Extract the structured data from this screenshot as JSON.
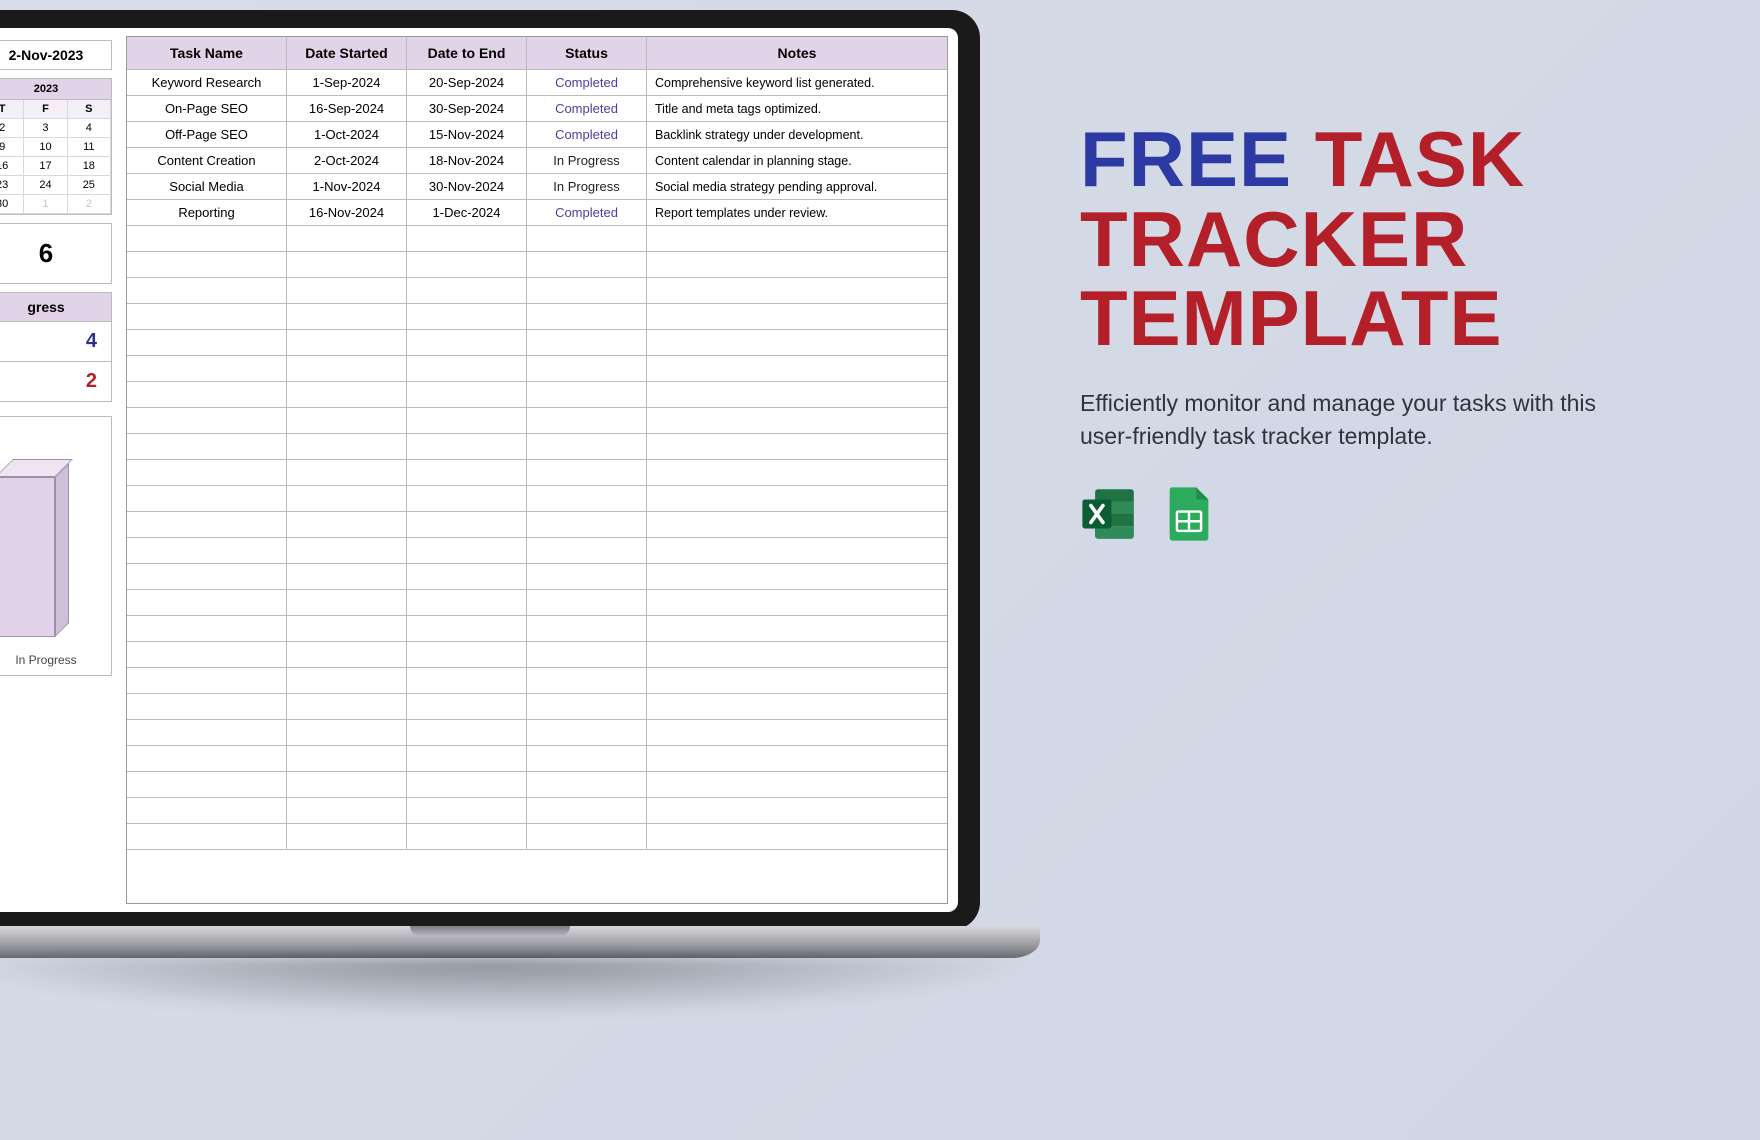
{
  "left": {
    "date_label": "2-Nov-2023",
    "calendar": {
      "year": "2023",
      "day_headers": [
        "T",
        "F",
        "S"
      ],
      "rows": [
        [
          "2",
          "3",
          "4"
        ],
        [
          "9",
          "10",
          "11"
        ],
        [
          "16",
          "17",
          "18"
        ],
        [
          "23",
          "24",
          "25"
        ],
        [
          "30",
          "1",
          "2"
        ]
      ],
      "dim_last_row_from": 1
    },
    "big_number": "6",
    "progress_header": "gress",
    "stats": {
      "completed": "4",
      "in_progress": "2"
    },
    "bar_label": "In Progress"
  },
  "table": {
    "headers": [
      "Task Name",
      "Date Started",
      "Date to End",
      "Status",
      "Notes"
    ],
    "rows": [
      {
        "name": "Keyword Research",
        "start": "1-Sep-2024",
        "end": "20-Sep-2024",
        "status": "Completed",
        "notes": "Comprehensive keyword list generated."
      },
      {
        "name": "On-Page SEO",
        "start": "16-Sep-2024",
        "end": "30-Sep-2024",
        "status": "Completed",
        "notes": "Title and meta tags optimized."
      },
      {
        "name": "Off-Page SEO",
        "start": "1-Oct-2024",
        "end": "15-Nov-2024",
        "status": "Completed",
        "notes": "Backlink strategy under development."
      },
      {
        "name": "Content Creation",
        "start": "2-Oct-2024",
        "end": "18-Nov-2024",
        "status": "In Progress",
        "notes": "Content calendar in planning stage."
      },
      {
        "name": "Social Media",
        "start": "1-Nov-2024",
        "end": "30-Nov-2024",
        "status": "In Progress",
        "notes": "Social media strategy pending approval."
      },
      {
        "name": "Reporting",
        "start": "16-Nov-2024",
        "end": "1-Dec-2024",
        "status": "Completed",
        "notes": "Report templates under review."
      }
    ],
    "empty_rows": 24
  },
  "promo": {
    "title_words": [
      {
        "text": "FREE",
        "color": "blue"
      },
      {
        "text": "TASK",
        "color": "red"
      },
      {
        "text": "TRACKER",
        "color": "red"
      },
      {
        "text": "TEMPLATE",
        "color": "red"
      }
    ],
    "subtitle": "Efficiently monitor and manage your tasks with this user-friendly task tracker template.",
    "icons": [
      "excel-icon",
      "google-sheets-icon"
    ]
  }
}
